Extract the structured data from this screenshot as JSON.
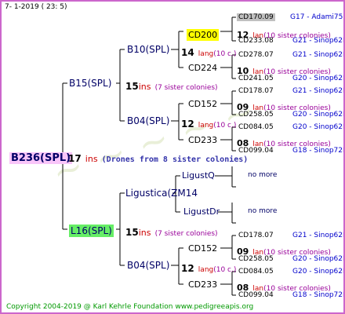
{
  "header": {
    "date": "7-   1-2019  ( 23:   5)"
  },
  "footer": {
    "copyright": "Copyright 2004-2019 @ Karl Kehrle Foundation    www.pedigreeapis.org"
  },
  "colors": {
    "frame": "#cc66cc",
    "root_highlight": "#f9c5f9",
    "green_highlight": "#66ee66",
    "yellow_highlight": "#ffff00",
    "gray_highlight": "#c0c0c0"
  },
  "root": {
    "name": "B236(SPL)",
    "num": "17",
    "ins": "ins",
    "note": "(Drones from 8 sister colonies)"
  },
  "b15": {
    "name": "B15(SPL)",
    "num": "15",
    "ins": "ins",
    "note": "(7 sister colonies)"
  },
  "b10": {
    "name": "B10(SPL)",
    "num": "14",
    "lang": "lang",
    "note": "(10 c.)"
  },
  "cd200": {
    "name": "CD200",
    "num": "12",
    "lan": "lan",
    "note": "(10 sister colonies)"
  },
  "cd224": {
    "name": "CD224",
    "num": "10",
    "lan": "lan",
    "note": "(10 sister colonies)"
  },
  "b04a": {
    "name": "B04(SPL)",
    "num": "12",
    "lang": "lang",
    "note": "(10 c.)"
  },
  "cd152a": {
    "name": "CD152",
    "num": "09",
    "lan": "lan",
    "note": "(10 sister colonies)"
  },
  "cd233a": {
    "name": "CD233",
    "num": "08",
    "lan": "lan",
    "note": "(10 sister colonies)"
  },
  "l16": {
    "name": "L16(SPL)",
    "num": "15",
    "ins": "ins",
    "note": "(7 sister colonies)"
  },
  "ligustica": {
    "name": "Ligustica(ZM14"
  },
  "ligustq": {
    "name": "LigustQ",
    "more": "no more"
  },
  "ligustdr": {
    "name": "LigustDr",
    "more": "no more"
  },
  "b04b": {
    "name": "B04(SPL)",
    "num": "12",
    "lang": "lang",
    "note": "(10 c.)"
  },
  "cd152b": {
    "name": "CD152",
    "num": "09",
    "lan": "lan",
    "note": "(10 sister colonies)"
  },
  "cd233b": {
    "name": "CD233",
    "num": "08",
    "lan": "lan",
    "note": "(10 sister colonies)"
  },
  "refs": {
    "cd170": {
      "name": "CD170.09",
      "gen": "G17 - Adami75R"
    },
    "cd233_08a": {
      "name": "CD233.08",
      "gen": "G21 - Sinop62R"
    },
    "cd278": {
      "name": "CD278.07",
      "gen": "G21 - Sinop62R"
    },
    "cd241": {
      "name": "CD241.05",
      "gen": "G20 - Sinop62R"
    },
    "cd178a": {
      "name": "CD178.07",
      "gen": "G21 - Sinop62R"
    },
    "cd258a": {
      "name": "CD258.05",
      "gen": "G20 - Sinop62R"
    },
    "cd084a": {
      "name": "CD084.05",
      "gen": "G20 - Sinop62R"
    },
    "cd099a": {
      "name": "CD099.04",
      "gen": "G18 - Sinop72R"
    },
    "cd178b": {
      "name": "CD178.07",
      "gen": "G21 - Sinop62R"
    },
    "cd258b": {
      "name": "CD258.05",
      "gen": "G20 - Sinop62R"
    },
    "cd084b": {
      "name": "CD084.05",
      "gen": "G20 - Sinop62R"
    },
    "cd099b": {
      "name": "CD099.04",
      "gen": "G18 - Sinop72R"
    }
  }
}
